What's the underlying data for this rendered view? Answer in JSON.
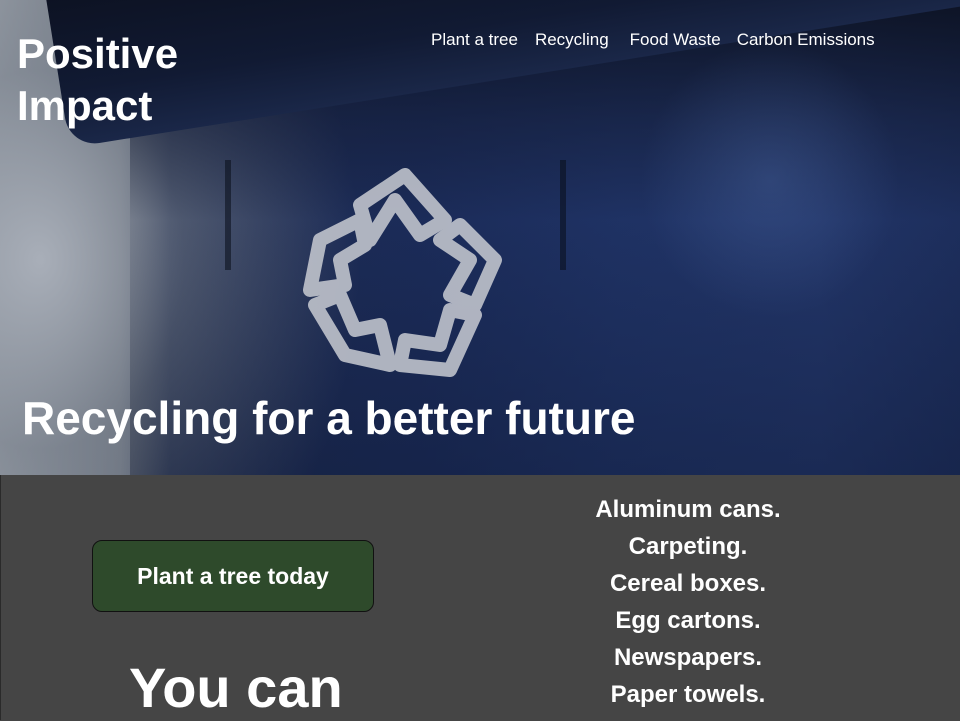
{
  "brand": {
    "line1": "Positive",
    "line2": "Impact"
  },
  "nav": {
    "items": [
      {
        "label": "Plant a tree"
      },
      {
        "label": "Recycling"
      },
      {
        "label": "Food Waste"
      },
      {
        "label": "Carbon Emissions"
      }
    ]
  },
  "hero": {
    "title": "Recycling for a better future",
    "image_icon": "recycle-icon"
  },
  "cta": {
    "label": "Plant a tree today"
  },
  "you_can": {
    "text": "You can"
  },
  "recyclables": {
    "items": [
      "Aluminum cans.",
      "Carpeting.",
      "Cereal boxes.",
      "Egg cartons.",
      "Newspapers.",
      "Paper towels."
    ]
  },
  "colors": {
    "page_background": "#454545",
    "cta_background": "#2e4a2b",
    "text": "#ffffff",
    "bin_blue": "#1f3366"
  }
}
